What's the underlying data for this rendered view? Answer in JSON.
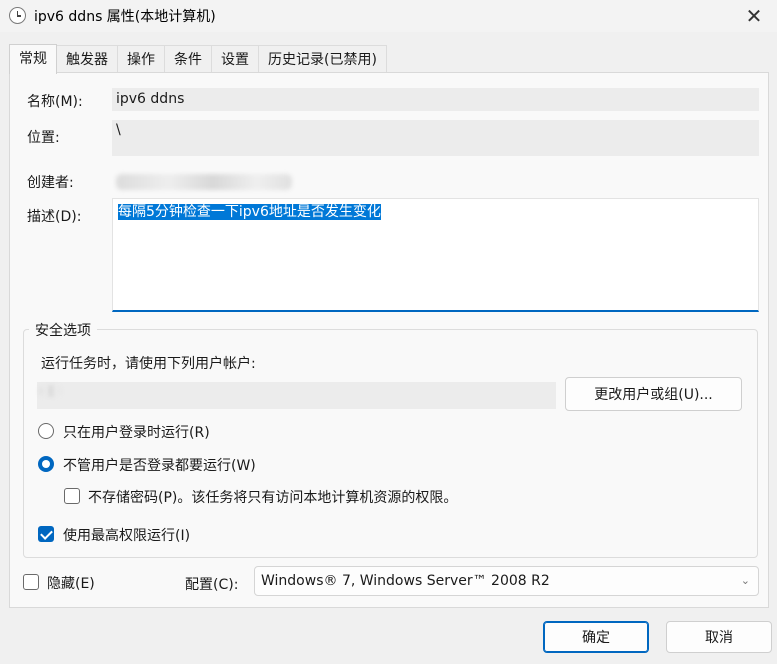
{
  "window": {
    "title": "ipv6 ddns 属性(本地计算机)",
    "close_glyph": "✕",
    "icon": "clock-icon"
  },
  "tabs": [
    {
      "label": "常规",
      "active": true
    },
    {
      "label": "触发器"
    },
    {
      "label": "操作"
    },
    {
      "label": "条件"
    },
    {
      "label": "设置"
    },
    {
      "label": "历史记录(已禁用)"
    }
  ],
  "general": {
    "name_label": "名称(M):",
    "name_value": "ipv6 ddns",
    "location_label": "位置:",
    "location_value": "\\",
    "author_label": "创建者:",
    "description_label": "描述(D):",
    "description_value": "每隔5分钟检查一下ipv6地址是否发生变化"
  },
  "security": {
    "group_title": "安全选项",
    "run_as_prompt": "运行任务时，请使用下列用户帐户:",
    "change_user_button": "更改用户或组(U)...",
    "option_logged_on": "只在用户登录时运行(R)",
    "option_whether_logged": "不管用户是否登录都要运行(W)",
    "no_store_password": "不存储密码(P)。该任务将只有访问本地计算机资源的权限。",
    "highest_privileges": "使用最高权限运行(I)",
    "state": {
      "run_mode": "whether_logged_on",
      "no_store_password": false,
      "highest_privileges": true
    }
  },
  "bottom": {
    "hidden_label": "隐藏(E)",
    "hidden_checked": false,
    "config_label": "配置(C):",
    "config_value": "Windows® 7, Windows Server™ 2008 R2",
    "chevron": "⌄"
  },
  "buttons": {
    "ok": "确定",
    "cancel": "取消"
  },
  "colors": {
    "accent": "#0067c0",
    "selection": "#0078d7"
  }
}
